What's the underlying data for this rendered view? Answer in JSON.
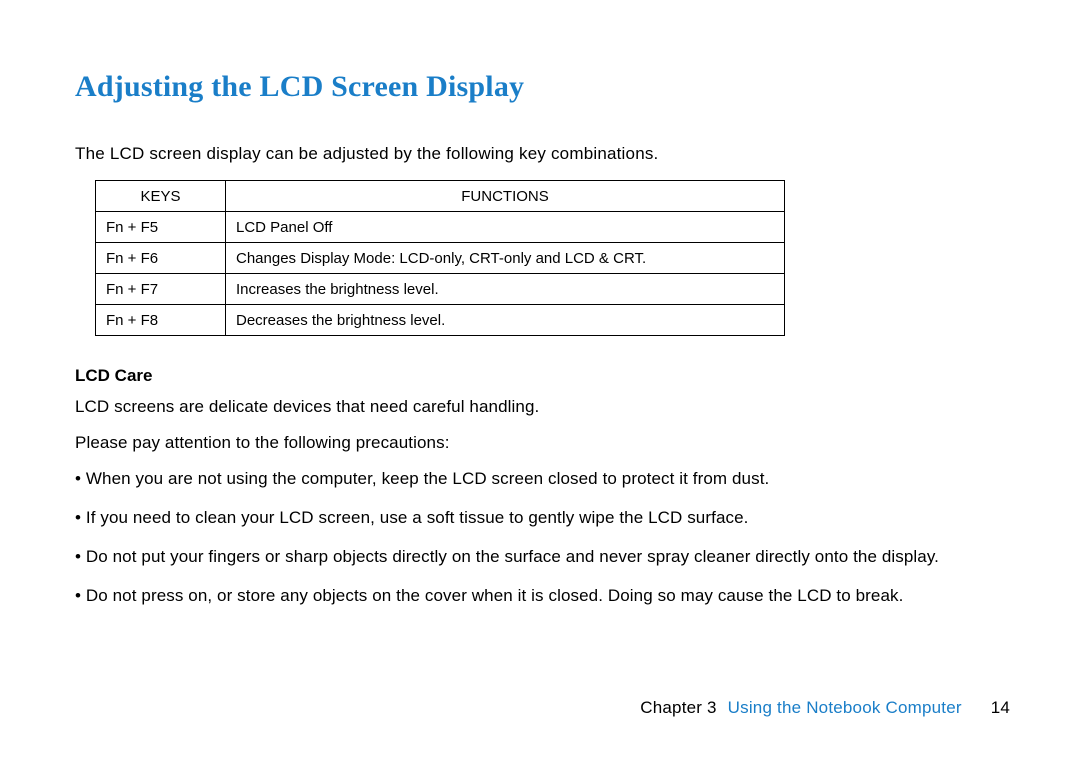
{
  "title": "Adjusting the LCD Screen Display",
  "intro": "The LCD screen display can be adjusted by the following key combinations.",
  "table": {
    "headers": {
      "keys": "KEYS",
      "functions": "FUNCTIONS"
    },
    "rows": [
      {
        "keys": "Fn + F5",
        "func": "LCD Panel Off"
      },
      {
        "keys": "Fn + F6",
        "func": "Changes Display Mode: LCD-only, CRT-only and LCD & CRT."
      },
      {
        "keys": "Fn + F7",
        "func": "Increases the brightness level."
      },
      {
        "keys": "Fn + F8",
        "func": "Decreases the brightness level."
      }
    ]
  },
  "lcd_care": {
    "heading": "LCD Care",
    "line1": "LCD screens are delicate devices that need careful handling.",
    "line2": "Please pay attention to the following precautions:",
    "bullets": [
      "• When you are not using the computer, keep the LCD screen closed to protect it from dust.",
      "• If you need to clean your LCD screen, use a soft tissue to gently wipe the LCD surface.",
      "• Do not put your fingers or sharp objects directly on the surface and never spray cleaner directly onto the display.",
      "• Do not press on, or store any objects on the cover when it is closed. Doing so may cause the LCD to break."
    ]
  },
  "footer": {
    "chapter_label": "Chapter 3",
    "chapter_title": "Using the Notebook Computer",
    "page_number": "14"
  }
}
